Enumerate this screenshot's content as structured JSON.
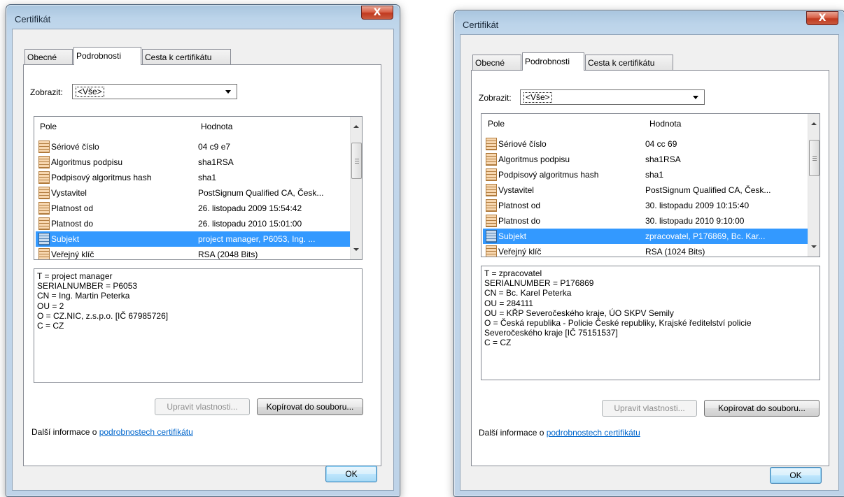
{
  "colors": {
    "selection": "#3399ff",
    "link": "#0066cc",
    "close_button": "#c13a1f",
    "frame": "#bcd4ea"
  },
  "dialogs": [
    {
      "title": "Certifikát",
      "close_label": "X",
      "tabs": [
        "Obecné",
        "Podrobnosti",
        "Cesta k certifikátu"
      ],
      "active_tab": "Podrobnosti",
      "show_label": "Zobrazit:",
      "show_value": "<Vše>",
      "list_headers": {
        "field": "Pole",
        "value": "Hodnota"
      },
      "rows": [
        {
          "field": "Sériové číslo",
          "value": "04 c9 e7"
        },
        {
          "field": "Algoritmus podpisu",
          "value": "sha1RSA"
        },
        {
          "field": "Podpisový algoritmus hash",
          "value": "sha1"
        },
        {
          "field": "Vystavitel",
          "value": "PostSignum Qualified CA, Česk..."
        },
        {
          "field": "Platnost od",
          "value": "26. listopadu 2009 15:54:42"
        },
        {
          "field": "Platnost do",
          "value": "26. listopadu 2010 15:01:00"
        },
        {
          "field": "Subjekt",
          "value": "project manager, P6053, Ing. ..."
        },
        {
          "field": "Veřejný klíč",
          "value": "RSA (2048 Bits)"
        }
      ],
      "selected_row": "Subjekt",
      "detail_lines": [
        "T = project manager",
        "SERIALNUMBER = P6053",
        "CN = Ing. Martin Peterka",
        "OU = 2",
        "O = CZ.NIC, z.s.p.o. [IČ 67985726]",
        "C = CZ"
      ],
      "edit_button": "Upravit vlastnosti...",
      "copy_button": "Kopírovat do souboru...",
      "more_info_text": "Další informace o ",
      "more_info_link": "podrobnostech certifikátu",
      "ok_button": "OK"
    },
    {
      "title": "Certifikát",
      "close_label": "X",
      "tabs": [
        "Obecné",
        "Podrobnosti",
        "Cesta k certifikátu"
      ],
      "active_tab": "Podrobnosti",
      "show_label": "Zobrazit:",
      "show_value": "<Vše>",
      "list_headers": {
        "field": "Pole",
        "value": "Hodnota"
      },
      "rows": [
        {
          "field": "Sériové číslo",
          "value": "04 cc 69"
        },
        {
          "field": "Algoritmus podpisu",
          "value": "sha1RSA"
        },
        {
          "field": "Podpisový algoritmus hash",
          "value": "sha1"
        },
        {
          "field": "Vystavitel",
          "value": "PostSignum Qualified CA, Česk..."
        },
        {
          "field": "Platnost od",
          "value": "30. listopadu 2009 10:15:40"
        },
        {
          "field": "Platnost do",
          "value": "30. listopadu 2010 9:10:00"
        },
        {
          "field": "Subjekt",
          "value": "zpracovatel, P176869, Bc. Kar..."
        },
        {
          "field": "Veřejný klíč",
          "value": "RSA (1024 Bits)"
        }
      ],
      "selected_row": "Subjekt",
      "detail_lines": [
        "T = zpracovatel",
        "SERIALNUMBER = P176869",
        "CN = Bc. Karel Peterka",
        "OU = 284111",
        "OU = KŘP Severočeského kraje, ÚO SKPV Semily",
        "O = Česká republika - Policie České republiky, Krajské ředitelství policie",
        "Severočeského kraje [IČ 75151537]",
        "C = CZ"
      ],
      "edit_button": "Upravit vlastnosti...",
      "copy_button": "Kopírovat do souboru...",
      "more_info_text": "Další informace o ",
      "more_info_link": "podrobnostech certifikátu",
      "ok_button": "OK"
    }
  ]
}
